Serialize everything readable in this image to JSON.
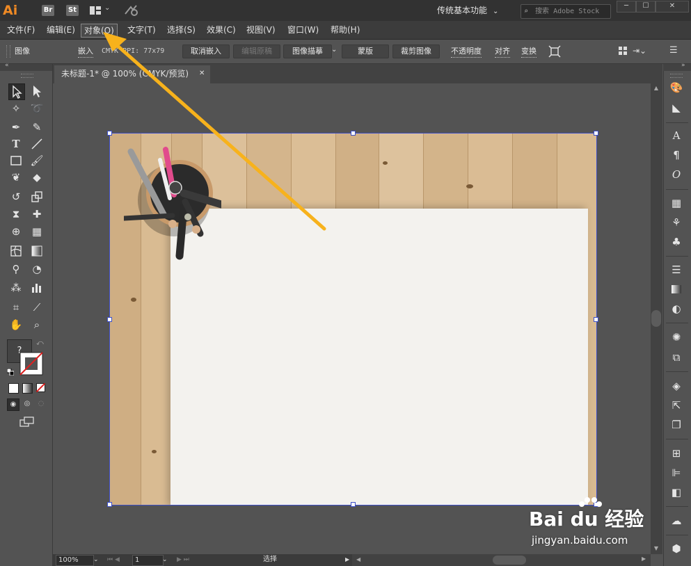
{
  "app": {
    "logo": "Ai",
    "bridge": "Br",
    "stock_app": "St",
    "workspace": "传统基本功能",
    "search_placeholder": "搜索 Adobe Stock",
    "window_controls": [
      "─",
      "☐",
      "✕"
    ]
  },
  "menu": {
    "items": [
      {
        "label": "文件(F)"
      },
      {
        "label": "编辑(E)"
      },
      {
        "label": "对象(O)"
      },
      {
        "label": "文字(T)"
      },
      {
        "label": "选择(S)"
      },
      {
        "label": "效果(C)"
      },
      {
        "label": "视图(V)"
      },
      {
        "label": "窗口(W)"
      },
      {
        "label": "帮助(H)"
      }
    ]
  },
  "control": {
    "type_label": "图像",
    "embed_label": "嵌入",
    "info": "CMYK  PPI: 77x79",
    "unembed": "取消嵌入",
    "edit_original": "编辑原稿",
    "image_trace": "图像描摹",
    "mask": "蒙版",
    "crop": "裁剪图像",
    "opacity": "不透明度",
    "align": "对齐",
    "transform": "变换"
  },
  "document": {
    "tab_title": "未标题-1* @ 100% (CMYK/预览)",
    "close": "✕"
  },
  "status": {
    "zoom": "100%",
    "page": "1",
    "tool": "选择"
  },
  "toolbar": {
    "color_unknown": "?"
  },
  "watermark": {
    "brand": "Bai du 经验",
    "url": "jingyan.baidu.com"
  },
  "annotation": {
    "arrow_color": "#f7b21c"
  }
}
